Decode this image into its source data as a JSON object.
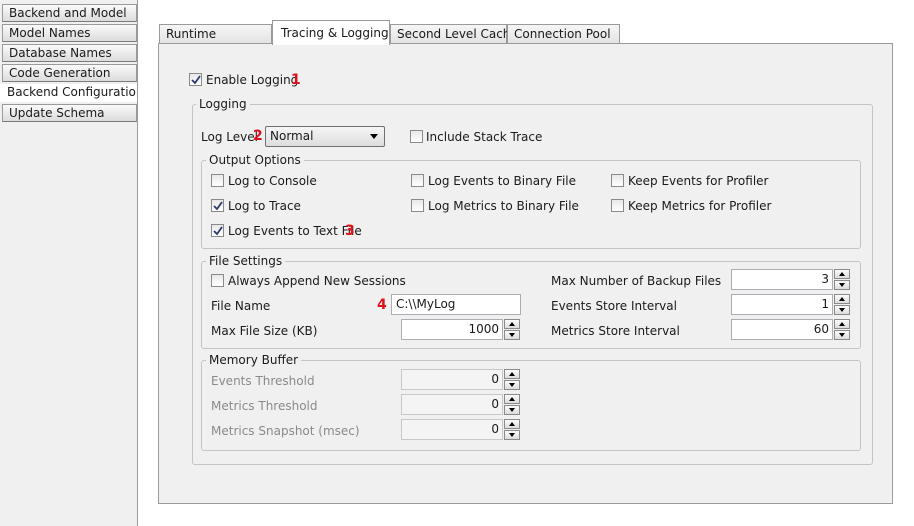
{
  "nav": {
    "items": [
      {
        "label": "Backend and Model",
        "active": false
      },
      {
        "label": "Model Names",
        "active": false
      },
      {
        "label": "Database Names",
        "active": false
      },
      {
        "label": "Code Generation",
        "active": false
      },
      {
        "label": "Backend Configuration",
        "active": true
      },
      {
        "label": "Update Schema",
        "active": false
      }
    ]
  },
  "tabs": [
    {
      "label": "Runtime",
      "active": false
    },
    {
      "label": "Tracing & Logging",
      "active": true
    },
    {
      "label": "Second Level Cache",
      "active": false
    },
    {
      "label": "Connection Pool",
      "active": false
    }
  ],
  "enable_logging": {
    "label": "Enable Logging",
    "checked": true,
    "marker": "1"
  },
  "logging_group": {
    "title": "Logging",
    "log_level_label": "Log Level",
    "log_level_marker": "2",
    "log_level_value": "Normal",
    "include_stack_trace": {
      "label": "Include Stack Trace",
      "checked": false
    }
  },
  "output_options": {
    "title": "Output Options",
    "log_to_console": {
      "label": "Log to Console",
      "checked": false
    },
    "log_to_trace": {
      "label": "Log to Trace",
      "checked": true
    },
    "log_events_text": {
      "label": "Log Events to Text File",
      "checked": true,
      "marker": "3"
    },
    "log_events_binary": {
      "label": "Log Events to Binary File",
      "checked": false
    },
    "log_metrics_binary": {
      "label": "Log Metrics to Binary File",
      "checked": false
    },
    "keep_events_profiler": {
      "label": "Keep Events for Profiler",
      "checked": false
    },
    "keep_metrics_profiler": {
      "label": "Keep Metrics for Profiler",
      "checked": false
    }
  },
  "file_settings": {
    "title": "File Settings",
    "always_append": {
      "label": "Always Append New Sessions",
      "checked": false
    },
    "file_name_label": "File Name",
    "file_name_marker": "4",
    "file_name_value": "C:\\\\MyLog",
    "max_file_size_label": "Max File Size (KB)",
    "max_file_size_value": "1000",
    "max_backup_label": "Max Number of Backup Files",
    "max_backup_value": "3",
    "events_interval_label": "Events Store Interval",
    "events_interval_value": "1",
    "metrics_interval_label": "Metrics Store Interval",
    "metrics_interval_value": "60"
  },
  "memory_buffer": {
    "title": "Memory Buffer",
    "events_threshold_label": "Events Threshold",
    "events_threshold_value": "0",
    "metrics_threshold_label": "Metrics Threshold",
    "metrics_threshold_value": "0",
    "metrics_snapshot_label": "Metrics Snapshot (msec)",
    "metrics_snapshot_value": "0"
  },
  "colors": {
    "marker": "#e0101a",
    "panel": "#f0f0f0",
    "content": "#ffffff"
  }
}
